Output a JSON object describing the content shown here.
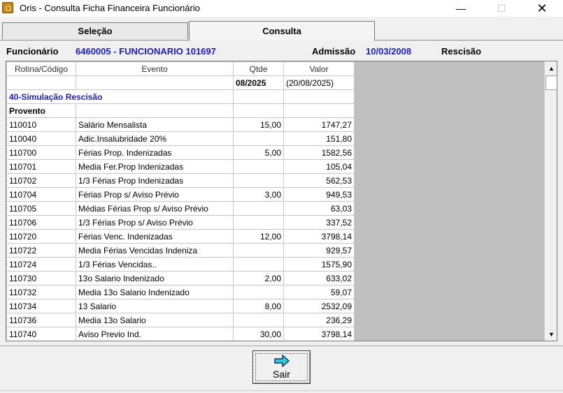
{
  "window": {
    "title": "Oris - Consulta Ficha Financeira Funcionário",
    "minimize": "—",
    "maximize": "☐",
    "close": "✕"
  },
  "tabs": [
    "Seleção",
    "Consulta"
  ],
  "info": {
    "funcionario_label": "Funcionário",
    "funcionario_value": "6460005 - FUNCIONARIO 101697",
    "admissao_label": "Admissão",
    "admissao_value": "10/03/2008",
    "rescisao_label": "Rescisão"
  },
  "grid": {
    "headers": [
      "Rotina/Código",
      "Evento",
      "Qtde",
      "Valor"
    ],
    "period": {
      "qtde": "08/2025",
      "valor": "(20/08/2025)"
    },
    "section": "40-Simulação Rescisão",
    "group": "Provento",
    "rows": [
      {
        "code": "110010",
        "event": "Salário Mensalista",
        "qtde": "15,00",
        "valor": "1747,27"
      },
      {
        "code": "110040",
        "event": "Adic.Insalubridade 20%",
        "qtde": "",
        "valor": "151,80"
      },
      {
        "code": "110700",
        "event": "Férias Prop. Indenizadas",
        "qtde": "5,00",
        "valor": "1582,56"
      },
      {
        "code": "110701",
        "event": "Media Fer.Prop Indenizadas",
        "qtde": "",
        "valor": "105,04"
      },
      {
        "code": "110702",
        "event": "1/3 Férias Prop Indenizadas",
        "qtde": "",
        "valor": "562,53"
      },
      {
        "code": "110704",
        "event": "Férias Prop s/ Aviso Prévio",
        "qtde": "3,00",
        "valor": "949,53"
      },
      {
        "code": "110705",
        "event": "Médias Férias Prop s/ Aviso Prévio",
        "qtde": "",
        "valor": "63,03"
      },
      {
        "code": "110706",
        "event": "1/3 Férias Prop s/ Aviso Prévio",
        "qtde": "",
        "valor": "337,52"
      },
      {
        "code": "110720",
        "event": "Férias Venc. Indenizadas",
        "qtde": "12,00",
        "valor": "3798,14"
      },
      {
        "code": "110722",
        "event": "Media Férias Vencidas Indeniza",
        "qtde": "",
        "valor": "929,57"
      },
      {
        "code": "110724",
        "event": "1/3 Férias Vencidas..",
        "qtde": "",
        "valor": "1575,90"
      },
      {
        "code": "110730",
        "event": "13o Salario Indenizado",
        "qtde": "2,00",
        "valor": "633,02"
      },
      {
        "code": "110732",
        "event": "Media 13o Salario Indenizado",
        "qtde": "",
        "valor": "59,07"
      },
      {
        "code": "110734",
        "event": "13 Salario",
        "qtde": "8,00",
        "valor": "2532,09"
      },
      {
        "code": "110736",
        "event": "Media 13o Salario",
        "qtde": "",
        "valor": "236,29"
      },
      {
        "code": "110740",
        "event": "Aviso Previo Ind.",
        "qtde": "30,00",
        "valor": "3798,14"
      }
    ]
  },
  "buttons": {
    "exit": "Sair"
  },
  "icons": {
    "app": "oris-app-icon",
    "exit": "arrow-right-icon"
  },
  "colors": {
    "accent_text": "#1a1ad6",
    "grid_empty": "#c0c0c0"
  }
}
